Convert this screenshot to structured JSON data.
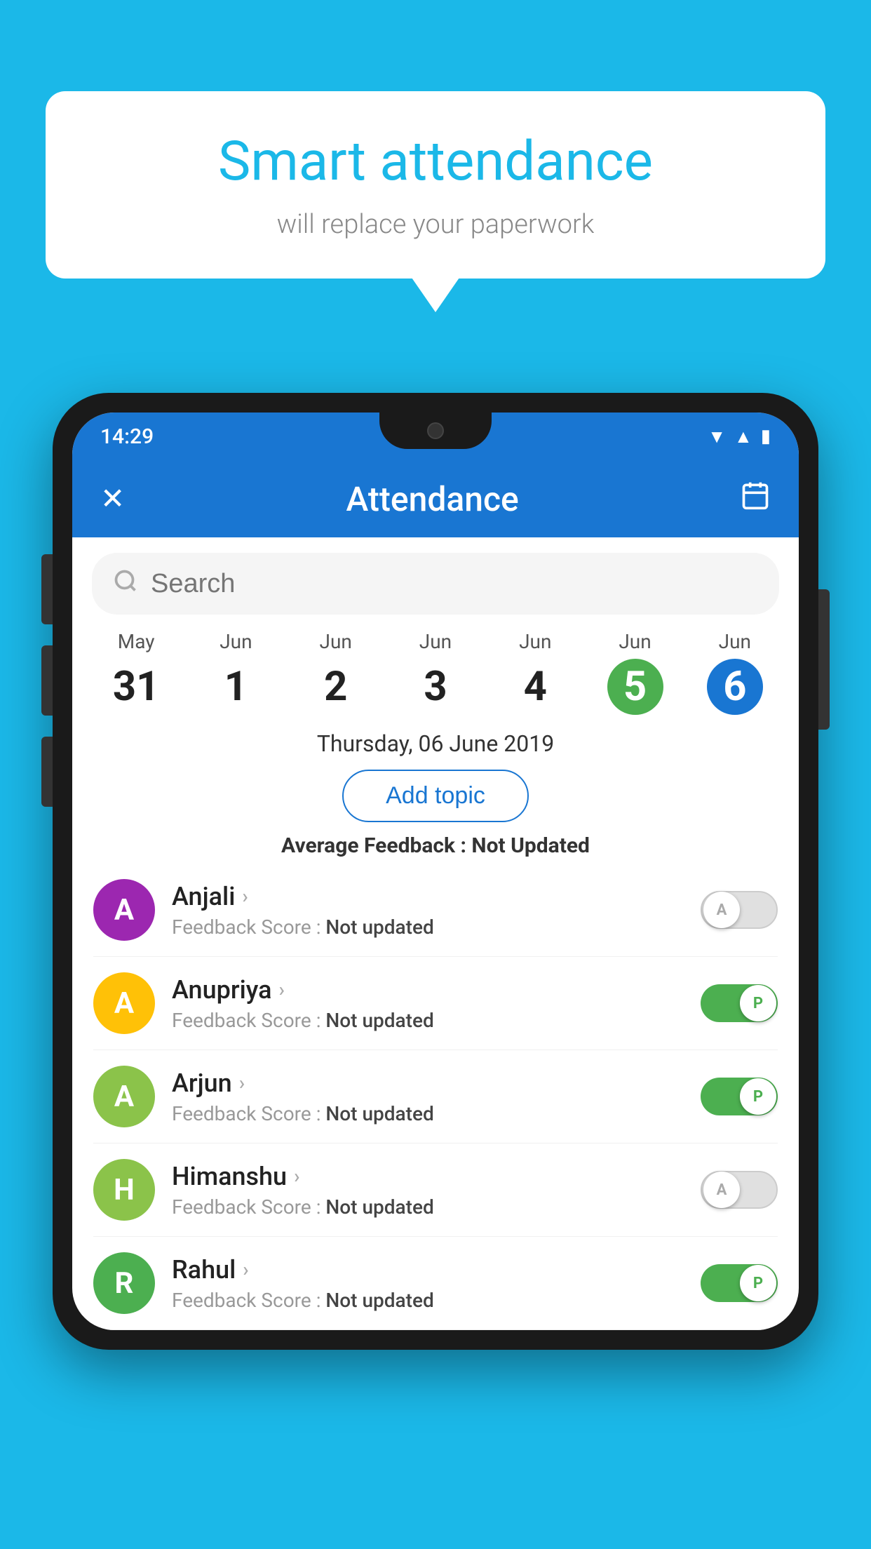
{
  "background_color": "#1BB8E8",
  "speech_bubble": {
    "title": "Smart attendance",
    "subtitle": "will replace your paperwork"
  },
  "status_bar": {
    "time": "14:29",
    "wifi": "▲",
    "signal": "▲",
    "battery": "▮"
  },
  "app_bar": {
    "title": "Attendance",
    "close_label": "✕",
    "calendar_label": "📅"
  },
  "search": {
    "placeholder": "Search"
  },
  "calendar": {
    "days": [
      {
        "month": "May",
        "date": "31",
        "state": "normal"
      },
      {
        "month": "Jun",
        "date": "1",
        "state": "normal"
      },
      {
        "month": "Jun",
        "date": "2",
        "state": "normal"
      },
      {
        "month": "Jun",
        "date": "3",
        "state": "normal"
      },
      {
        "month": "Jun",
        "date": "4",
        "state": "normal"
      },
      {
        "month": "Jun",
        "date": "5",
        "state": "today"
      },
      {
        "month": "Jun",
        "date": "6",
        "state": "selected"
      }
    ]
  },
  "selected_date": "Thursday, 06 June 2019",
  "add_topic_button": "Add topic",
  "average_feedback": {
    "label": "Average Feedback : ",
    "value": "Not Updated"
  },
  "students": [
    {
      "name": "Anjali",
      "avatar_letter": "A",
      "avatar_color": "#9C27B0",
      "feedback_label": "Feedback Score : ",
      "feedback_value": "Not updated",
      "toggle_state": "off",
      "toggle_label": "A"
    },
    {
      "name": "Anupriya",
      "avatar_letter": "A",
      "avatar_color": "#FFC107",
      "feedback_label": "Feedback Score : ",
      "feedback_value": "Not updated",
      "toggle_state": "on",
      "toggle_label": "P"
    },
    {
      "name": "Arjun",
      "avatar_letter": "A",
      "avatar_color": "#8BC34A",
      "feedback_label": "Feedback Score : ",
      "feedback_value": "Not updated",
      "toggle_state": "on",
      "toggle_label": "P"
    },
    {
      "name": "Himanshu",
      "avatar_letter": "H",
      "avatar_color": "#8BC34A",
      "feedback_label": "Feedback Score : ",
      "feedback_value": "Not updated",
      "toggle_state": "off",
      "toggle_label": "A"
    },
    {
      "name": "Rahul",
      "avatar_letter": "R",
      "avatar_color": "#4CAF50",
      "feedback_label": "Feedback Score : ",
      "feedback_value": "Not updated",
      "toggle_state": "on",
      "toggle_label": "P"
    }
  ]
}
